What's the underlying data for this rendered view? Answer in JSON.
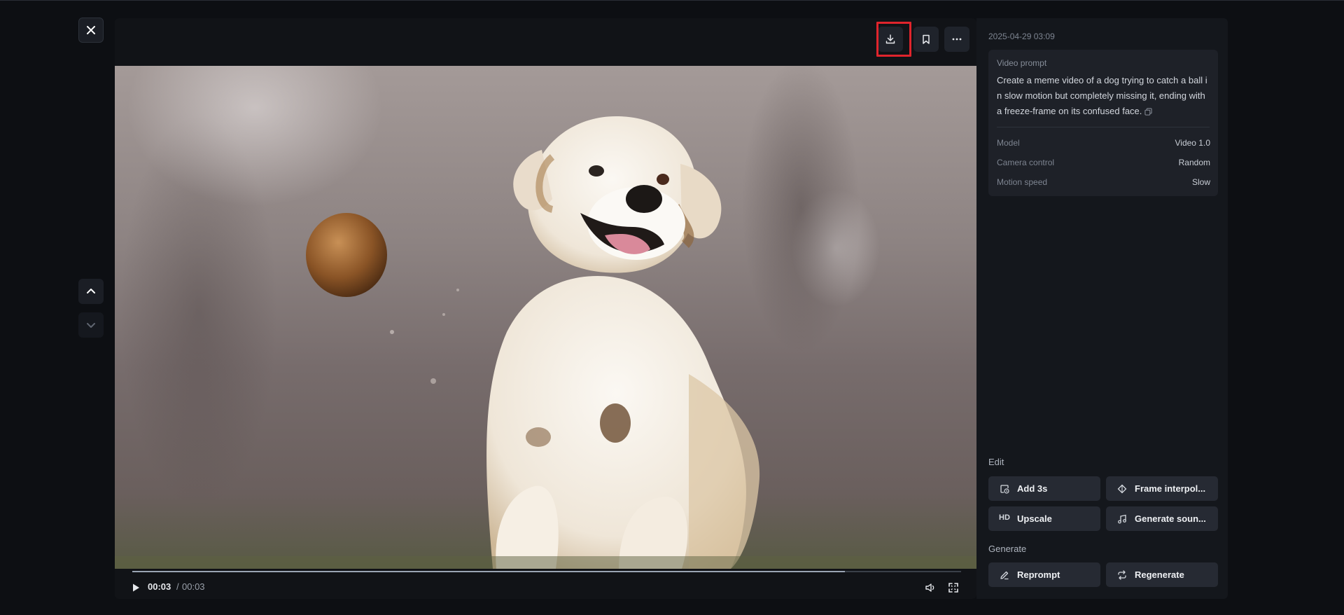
{
  "viewer": {
    "close_icon": "close-icon",
    "prev_icon": "chevron-up-icon",
    "next_icon": "chevron-down-icon"
  },
  "toolbar": {
    "download_icon": "download-icon",
    "bookmark_icon": "bookmark-icon",
    "more_icon": "more-horizontal-icon"
  },
  "player": {
    "current_time": "00:03",
    "separator": "/",
    "total_time": "00:03",
    "progress": 0.86
  },
  "panel": {
    "timestamp": "2025-04-29 03:09",
    "prompt_label": "Video prompt",
    "prompt_text": "Create a meme video of a dog trying to catch a ball in slow motion but completely missing it, ending with a freeze-frame on its confused face.",
    "meta": [
      {
        "key": "Model",
        "value": "Video 1.0"
      },
      {
        "key": "Camera control",
        "value": "Random"
      },
      {
        "key": "Motion speed",
        "value": "Slow"
      }
    ],
    "edit_label": "Edit",
    "edit_actions": [
      {
        "label": "Add 3s",
        "icon": "clock-plus-icon"
      },
      {
        "label": "Frame interpol...",
        "icon": "diamond-arrows-icon"
      },
      {
        "label": "Upscale",
        "icon_text": "HD"
      },
      {
        "label": "Generate soun...",
        "icon": "music-note-icon"
      }
    ],
    "generate_label": "Generate",
    "generate_actions": [
      {
        "label": "Reprompt",
        "icon": "pencil-icon"
      },
      {
        "label": "Regenerate",
        "icon": "repeat-icon"
      }
    ]
  },
  "colors": {
    "background": "#0d0f13",
    "panel": "#14171c",
    "highlight": "#e0242c"
  }
}
